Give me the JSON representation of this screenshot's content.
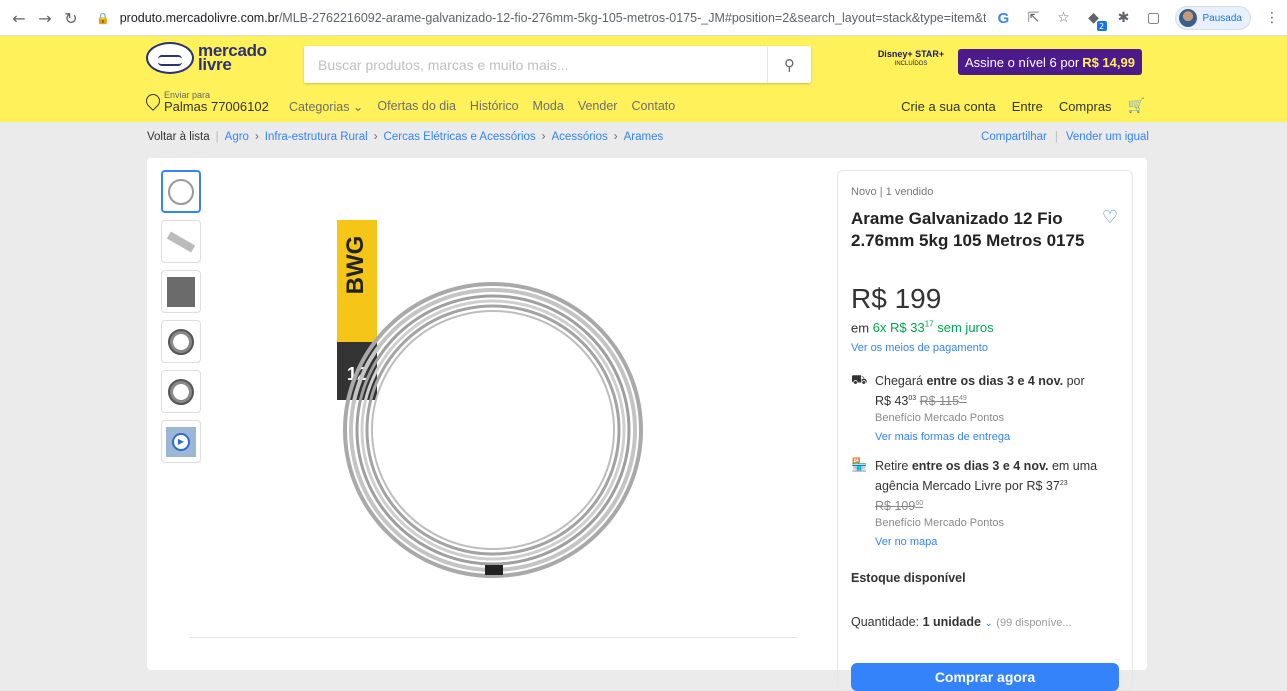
{
  "browser": {
    "url_host": "produto.mercadolivre.com.br",
    "url_path": "/MLB-2762216092-arame-galvanizado-12-fio-276mm-5kg-105-metros-0175-_JM#position=2&search_layout=stack&type=item&tracking_id...",
    "profile_label": "Pausada",
    "ext_badge": "2"
  },
  "header": {
    "logo_line1": "mercado",
    "logo_line2": "livre",
    "search_placeholder": "Buscar produtos, marcas e muito mais...",
    "disney_line1": "Disney+ STAR+",
    "disney_line2": "INCLUÍDOS",
    "promo_text": "Assine o nível 6 por",
    "promo_price": "R$ 14,99",
    "deliver_small": "Enviar para",
    "deliver_big": "Palmas 77006102",
    "nav": [
      "Categorias ⌄",
      "Ofertas do dia",
      "Histórico",
      "Moda",
      "Vender",
      "Contato"
    ],
    "nav_right": [
      "Crie a sua conta",
      "Entre",
      "Compras"
    ]
  },
  "breadcrumb": {
    "back": "Voltar à lista",
    "items": [
      "Agro",
      "Infra-estrutura Rural",
      "Cercas Elétricas e Acessórios",
      "Acessórios",
      "Arames"
    ],
    "share": "Compartilhar",
    "sell_same": "Vender um igual"
  },
  "product": {
    "condition": "Novo | 1 vendido",
    "title": "Arame Galvanizado 12 Fio 2.76mm 5kg 105 Metros 0175",
    "price": "R$ 199",
    "inst_prefix": "em",
    "inst_green": "6x R$ 33",
    "inst_cents": "17",
    "inst_suffix": "sem juros",
    "payment_link": "Ver os meios de pagamento",
    "label_bwg": "BWG",
    "label_gauge": "12"
  },
  "shipping": {
    "s1_pre": "Chegará",
    "s1_bold": "entre os dias 3 e 4 nov.",
    "s1_post": "por",
    "s1_price": "R$ 43",
    "s1_cents": "03",
    "s1_old": "R$ 115",
    "s1_old_cents": "49",
    "s1_benefit": "Benefício Mercado Pontos",
    "s1_link": "Ver mais formas de entrega",
    "s2_pre": "Retire",
    "s2_bold": "entre os dias 3 e 4 nov.",
    "s2_post": "em uma agência Mercado Livre por R$ 37",
    "s2_cents": "23",
    "s2_old": "R$ 109",
    "s2_old_cents": "60",
    "s2_benefit": "Benefício Mercado Pontos",
    "s2_link": "Ver no mapa"
  },
  "purchase": {
    "stock": "Estoque disponível",
    "qty_label": "Quantidade:",
    "qty_value": "1 unidade",
    "qty_avail": "(99 disponíve...",
    "buy_now": "Comprar agora"
  }
}
